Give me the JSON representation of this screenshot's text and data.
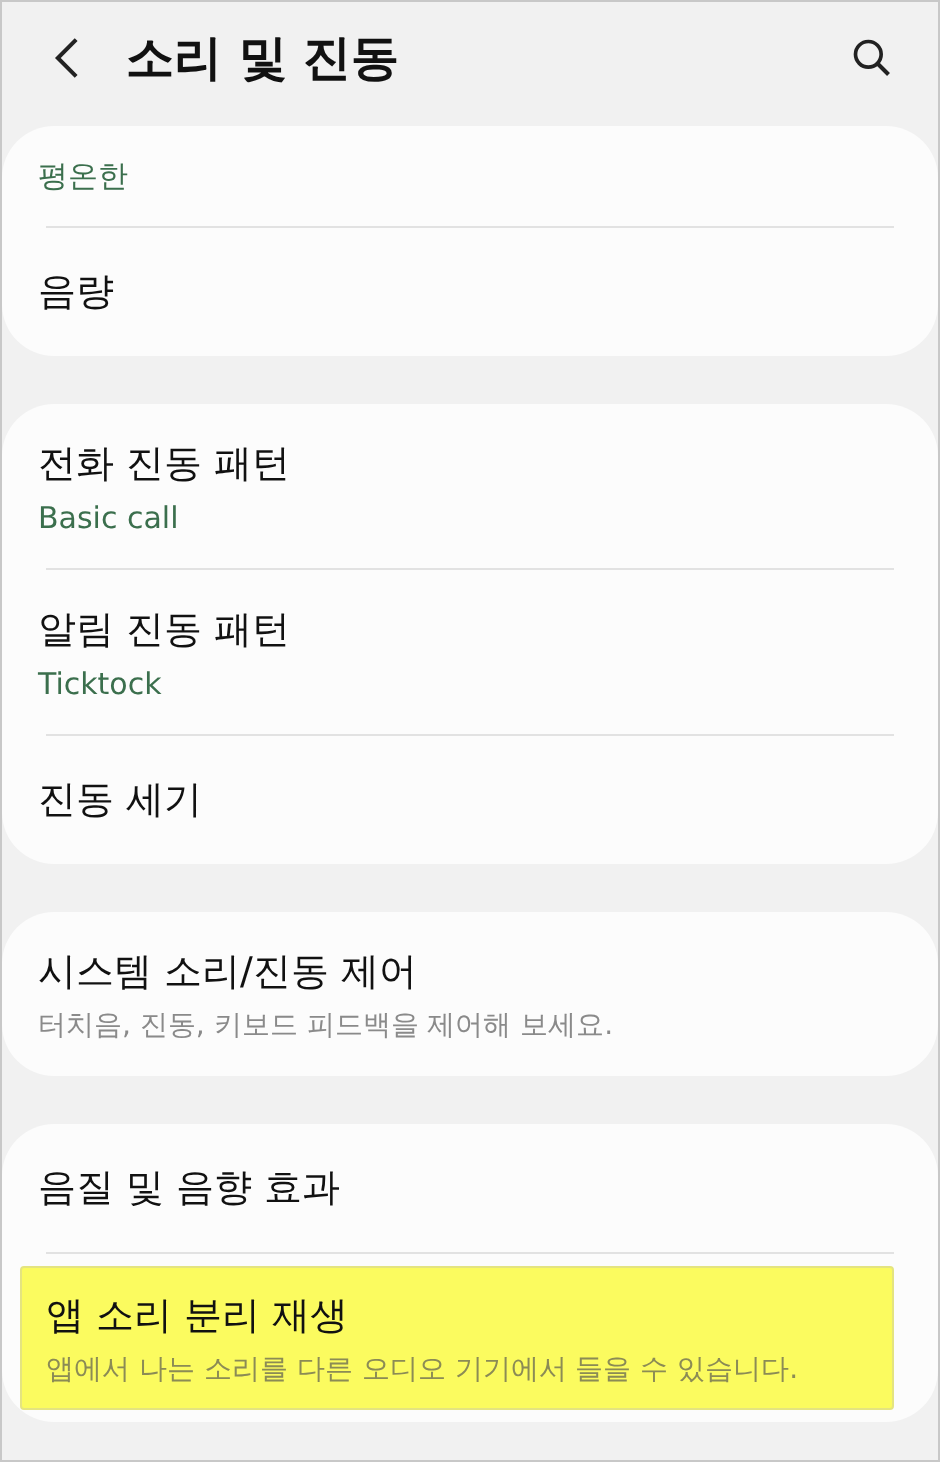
{
  "header": {
    "title": "소리 및 진동"
  },
  "groups": [
    {
      "items": [
        {
          "summary": "평온한",
          "highlighted": false
        },
        {
          "title": "음량",
          "highlighted": false
        }
      ]
    },
    {
      "items": [
        {
          "title": "전화 진동 패턴",
          "summary": "Basic call",
          "highlighted": false
        },
        {
          "title": "알림 진동 패턴",
          "summary": "Ticktock",
          "highlighted": false
        },
        {
          "title": "진동 세기",
          "highlighted": false
        }
      ]
    },
    {
      "items": [
        {
          "title": "시스템 소리/진동 제어",
          "description": "터치음, 진동, 키보드 피드백을 제어해 보세요.",
          "highlighted": false
        }
      ]
    },
    {
      "items": [
        {
          "title": "음질 및 음향 효과",
          "highlighted": false
        },
        {
          "title": "앱 소리 분리 재생",
          "description": "앱에서 나는 소리를 다른 오디오 기기에서 들을 수 있습니다.",
          "highlighted": true
        }
      ]
    }
  ]
}
